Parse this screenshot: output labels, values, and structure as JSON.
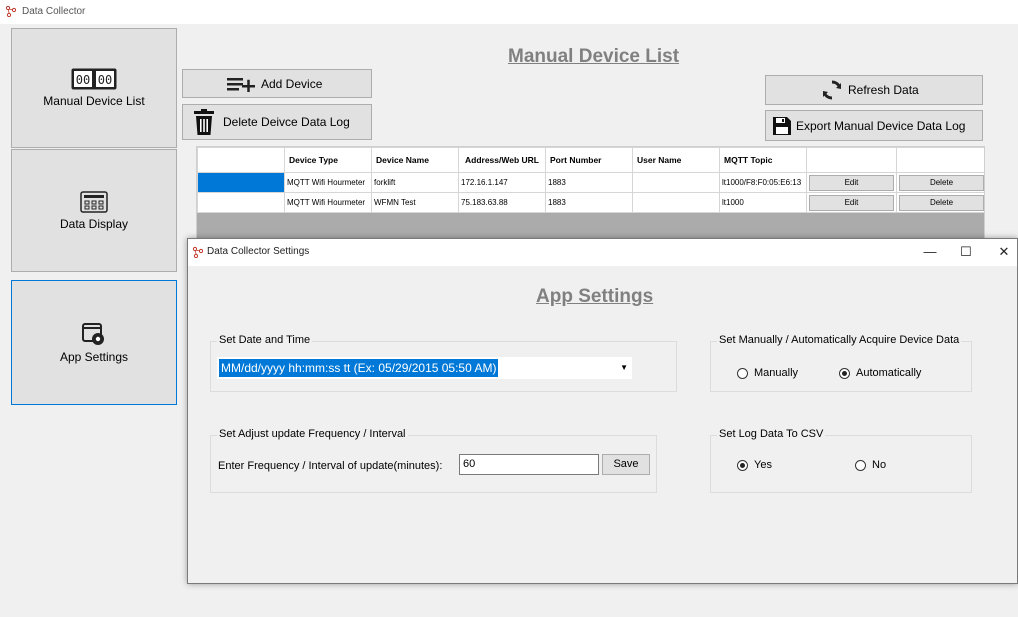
{
  "window": {
    "title": "Data Collector"
  },
  "nav": {
    "manual_label": "Manual Device List",
    "display_label": "Data Display",
    "settings_label": "App Settings",
    "manual_icon_text": "00:00"
  },
  "main": {
    "heading": "Manual Device List",
    "add_device_label": "Add Device",
    "delete_log_label": "Delete Deivce Data Log",
    "refresh_label": "Refresh Data",
    "export_label": "Export Manual Device Data Log"
  },
  "grid": {
    "headers": [
      "",
      "Device Type",
      "Device Name",
      "Address/Web URL",
      "Port Number",
      "User Name",
      "MQTT Topic",
      "",
      ""
    ],
    "rows": [
      {
        "type": "MQTT Wifi Hourmeter",
        "name": "forklift",
        "address": "172.16.1.147",
        "port": "1883",
        "user": "",
        "topic": "lt1000/F8:F0:05:E6:13",
        "edit": "Edit",
        "delete": "Delete"
      },
      {
        "type": "MQTT Wifi Hourmeter",
        "name": "WFMN Test",
        "address": "75.183.63.88",
        "port": "1883",
        "user": "",
        "topic": "lt1000",
        "edit": "Edit",
        "delete": "Delete"
      }
    ]
  },
  "dialog": {
    "title": "Data Collector Settings",
    "min_symbol": "—",
    "max_symbol": "☐",
    "close_symbol": "✕",
    "heading": "App Settings",
    "datetime_group": "Set Date and Time",
    "datetime_value": "MM/dd/yyyy hh:mm:ss tt (Ex: 05/29/2015 05:50 AM)",
    "acquire_group": "Set Manually / Automatically Acquire Device Data",
    "acquire_manual": "Manually",
    "acquire_auto": "Automatically",
    "acquire_selected": "Automatically",
    "freq_group": "Set Adjust update Frequency / Interval",
    "freq_label": "Enter Frequency / Interval of update(minutes):",
    "freq_value": "60",
    "save_label": "Save",
    "log_group": "Set Log Data To CSV",
    "log_yes": "Yes",
    "log_no": "No",
    "log_selected": "Yes"
  },
  "colors": {
    "selection": "#0078d7",
    "button_face": "#e1e1e1",
    "heading": "#808080"
  }
}
